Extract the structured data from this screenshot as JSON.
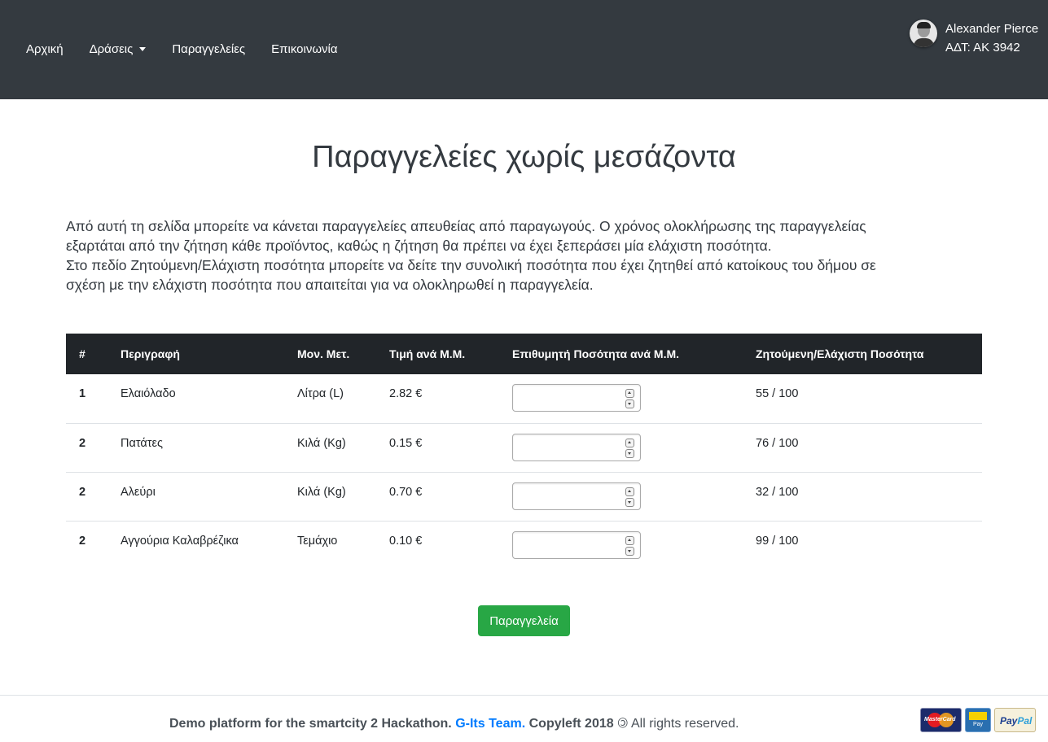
{
  "navbar": {
    "links": [
      "Αρχική",
      "Δράσεις",
      "Παραγγελείες",
      "Επικοινωνία"
    ],
    "user": {
      "name": "Alexander Pierce",
      "id_text": "ΑΔΤ: ΑΚ 3942"
    }
  },
  "main": {
    "title": "Παραγγελείες χωρίς μεσάζοντα",
    "intro_lines": [
      "Από αυτή τη σελίδα μπορείτε να κάνεται παραγγελείες απευθείας από παραγωγούς. Ο χρόνος ολοκλήρωσης της παραγγελείας",
      "εξαρτάται από την ζήτηση κάθε προϊόντος, καθώς η ζήτηση θα πρέπει να έχει ξεπεράσει μία ελάχιστη ποσότητα.",
      "Στο πεδίο Ζητούμενη/Ελάχιστη ποσότητα μπορείτε να δείτε την συνολική ποσότητα που έχει ζητηθεί από κατοίκους του δήμου σε",
      "σχέση με την ελάχιστη ποσότητα που απαιτείται για να ολοκληρωθεί η παραγγελεία."
    ],
    "table": {
      "headers": [
        "#",
        "Περιγραφή",
        "Μον. Μετ.",
        "Τιμή ανά Μ.Μ.",
        "Επιθυμητή Ποσότητα ανά Μ.Μ.",
        "Ζητούμενη/Ελάχιστη Ποσότητα"
      ],
      "rows": [
        {
          "num": "1",
          "desc": "Ελαιόλαδο",
          "unit": "Λίτρα (L)",
          "price": "2.82 €",
          "quantity": "",
          "demand": "55 / 100"
        },
        {
          "num": "2",
          "desc": "Πατάτες",
          "unit": "Κιλά (Kg)",
          "price": "0.15 €",
          "quantity": "",
          "demand": "76 / 100"
        },
        {
          "num": "2",
          "desc": "Αλεύρι",
          "unit": "Κιλά (Kg)",
          "price": "0.70 €",
          "quantity": "",
          "demand": "32 / 100"
        },
        {
          "num": "2",
          "desc": "Αγγούρια Καλαβρέζικα",
          "unit": "Τεμάχιο",
          "price": "0.10 €",
          "quantity": "",
          "demand": "99 / 100"
        }
      ]
    },
    "order_button": "Παραγγελεία"
  },
  "footer": {
    "text_bold": "Demo platform for the smartcity 2 Hackathon.",
    "team": "G-Its Team.",
    "copyleft": "Copyleft 2018",
    "rights": "All rights reserved.",
    "payment_icons": [
      "mastercard-icon",
      "diba-pay-icon",
      "paypal-icon"
    ],
    "mastercard_label": "MasterCard",
    "diba_label": "Pay",
    "paypal_label_1": "Pay",
    "paypal_label_2": "Pal"
  }
}
